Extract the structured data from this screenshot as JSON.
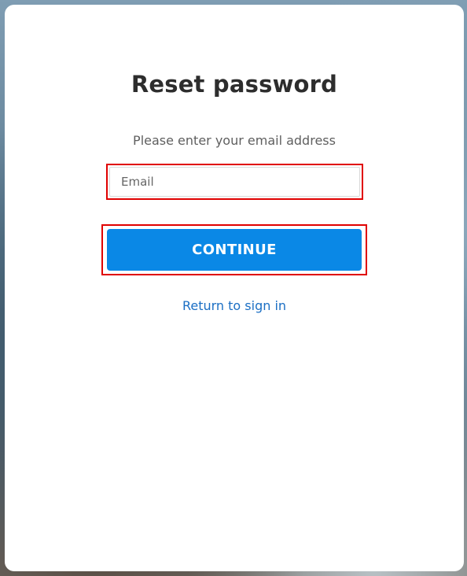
{
  "page": {
    "title": "Reset password",
    "subtitle": "Please enter your email address"
  },
  "form": {
    "email": {
      "placeholder": "Email",
      "value": ""
    },
    "continue_label": "CONTINUE",
    "return_link_label": "Return to sign in"
  },
  "colors": {
    "primary_button": "#0a88e6",
    "link": "#1b6fc4",
    "highlight_border": "#e00000",
    "title_text": "#2d2d2d",
    "subtitle_text": "#5f5f5f"
  }
}
